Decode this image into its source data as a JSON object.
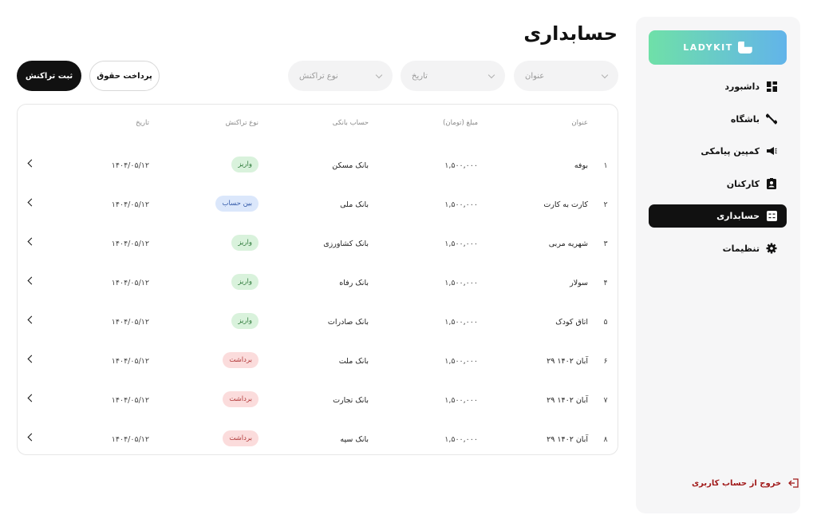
{
  "sidebar": {
    "logo_text": "LADYKIT",
    "items": [
      {
        "label": "داشبورد",
        "icon": "dashboard-icon",
        "active": false
      },
      {
        "label": "باشگاه",
        "icon": "dumbbell-icon",
        "active": false
      },
      {
        "label": "کمپین پیامکی",
        "icon": "megaphone-icon",
        "active": false
      },
      {
        "label": "کارکنان",
        "icon": "id-badge-icon",
        "active": false
      },
      {
        "label": "حسابداری",
        "icon": "calculator-icon",
        "active": true
      },
      {
        "label": "تنظیمات",
        "icon": "gear-icon",
        "active": false
      }
    ],
    "logout_label": "خروج از حساب کاربری"
  },
  "page": {
    "title": "حسابداری"
  },
  "filters": {
    "title_placeholder": "عنوان",
    "date_placeholder": "تاریخ",
    "type_placeholder": "نوع تراکنش"
  },
  "actions": {
    "add_transaction": "ثبت تراکنش",
    "pay_salary": "پرداخت حقوق"
  },
  "table": {
    "headers": {
      "title": "عنوان",
      "amount": "مبلغ (تومان)",
      "account": "حساب بانکی",
      "type": "نوع تراکنش",
      "date": "تاریخ"
    },
    "rows": [
      {
        "idx": "۱",
        "title": "بوفه",
        "amount": "۱,۵۰۰,۰۰۰",
        "account": "بانک مسکن",
        "type": "واریز",
        "kind": "deposit",
        "date": "۱۴۰۴/۰۵/۱۲"
      },
      {
        "idx": "۲",
        "title": "کارت به کارت",
        "amount": "۱,۵۰۰,۰۰۰",
        "account": "بانک ملی",
        "type": "بین حساب",
        "kind": "inter",
        "date": "۱۴۰۴/۰۵/۱۲"
      },
      {
        "idx": "۳",
        "title": "شهریه مربی",
        "amount": "۱,۵۰۰,۰۰۰",
        "account": "بانک کشاورزی",
        "type": "واریز",
        "kind": "deposit",
        "date": "۱۴۰۴/۰۵/۱۲"
      },
      {
        "idx": "۴",
        "title": "سولار",
        "amount": "۱,۵۰۰,۰۰۰",
        "account": "بانک رفاه",
        "type": "واریز",
        "kind": "deposit",
        "date": "۱۴۰۴/۰۵/۱۲"
      },
      {
        "idx": "۵",
        "title": "اتاق کودک",
        "amount": "۱,۵۰۰,۰۰۰",
        "account": "بانک صادرات",
        "type": "واریز",
        "kind": "deposit",
        "date": "۱۴۰۴/۰۵/۱۲"
      },
      {
        "idx": "۶",
        "title": "۲۹ آبان ۱۴۰۲",
        "amount": "۱,۵۰۰,۰۰۰",
        "account": "بانک ملت",
        "type": "برداشت",
        "kind": "withdraw",
        "date": "۱۴۰۴/۰۵/۱۲"
      },
      {
        "idx": "۷",
        "title": "۲۹ آبان ۱۴۰۲",
        "amount": "۱,۵۰۰,۰۰۰",
        "account": "بانک تجارت",
        "type": "برداشت",
        "kind": "withdraw",
        "date": "۱۴۰۴/۰۵/۱۲"
      },
      {
        "idx": "۸",
        "title": "۲۹ آبان ۱۴۰۲",
        "amount": "۱,۵۰۰,۰۰۰",
        "account": "بانک سپه",
        "type": "برداشت",
        "kind": "withdraw",
        "date": "۱۴۰۴/۰۵/۱۲"
      }
    ]
  }
}
